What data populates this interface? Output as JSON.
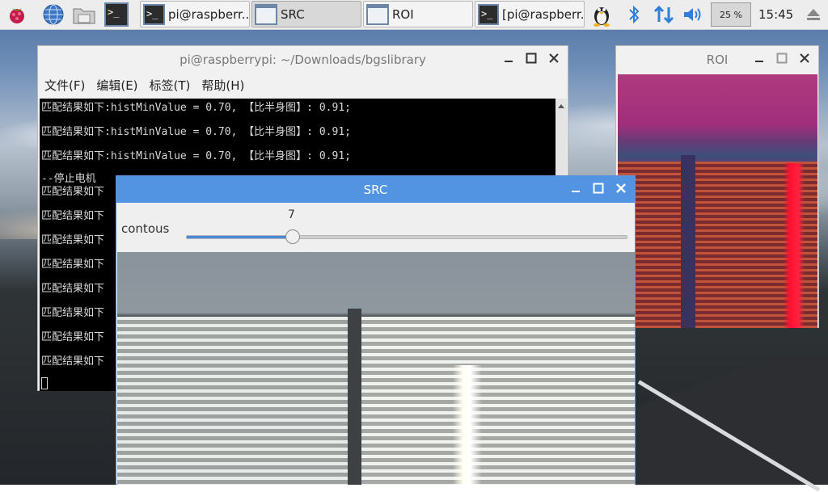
{
  "taskbar": {
    "apps": [
      {
        "label": "pi@raspberr...",
        "kind": "terminal"
      },
      {
        "label": "SRC",
        "kind": "window"
      },
      {
        "label": "ROI",
        "kind": "window"
      },
      {
        "label": "[pi@raspberr...",
        "kind": "terminal"
      }
    ],
    "cpu_usage": "25 %",
    "clock": "15:45"
  },
  "terminal": {
    "title": "pi@raspberrypi: ~/Downloads/bgslibrary",
    "menu": [
      "文件(F)",
      "编辑(E)",
      "标签(T)",
      "帮助(H)"
    ],
    "lines": [
      "匹配结果如下:histMinValue = 0.70, 【比半身图】: 0.91;",
      "匹配结果如下:histMinValue = 0.70, 【比半身图】: 0.91;",
      "匹配结果如下:histMinValue = 0.70, 【比半身图】: 0.91;",
      "--停止电机",
      "匹配结果如下",
      "匹配结果如下",
      "匹配结果如下",
      "匹配结果如下",
      "匹配结果如下",
      "匹配结果如下",
      "匹配结果如下",
      "匹配结果如下"
    ]
  },
  "roi": {
    "title": "ROI"
  },
  "src": {
    "title": "SRC",
    "trackbar_label": "contous",
    "trackbar_value": "7",
    "trackbar_fraction": 0.24
  },
  "colors": {
    "src_titlebar": "#5294e2",
    "slider_fill": "#4a88d8"
  }
}
